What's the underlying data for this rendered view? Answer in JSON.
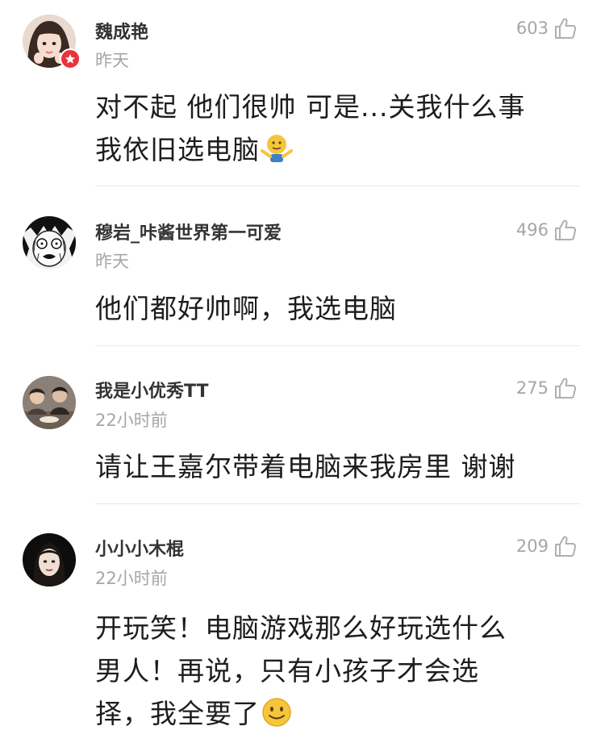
{
  "comments": [
    {
      "username": "魏成艳",
      "time": "昨天",
      "likes": "603",
      "lines": [
        "对不起 他们很帅 可是...关我什么事",
        "我依旧选电脑"
      ],
      "verified": true,
      "avatar_icon": "girl-avatar-icon",
      "trailing_emoji": "shrug-emoji-icon"
    },
    {
      "username": "穆岩_咔酱世界第一可爱",
      "time": "昨天",
      "likes": "496",
      "lines": [
        "他们都好帅啊，我选电脑"
      ],
      "avatar_icon": "manga-scared-face-icon"
    },
    {
      "username": "我是小优秀TT",
      "time": "22小时前",
      "likes": "275",
      "lines": [
        "请让王嘉尔带着电脑来我房里 谢谢"
      ],
      "avatar_icon": "group-photo-avatar-icon"
    },
    {
      "username": "小小小木棍",
      "time": "22小时前",
      "likes": "209",
      "lines": [
        "开玩笑！电脑游戏那么好玩选什么",
        "男人！再说，只有小孩子才会选",
        "择，我全要了"
      ],
      "avatar_icon": "woman-portrait-avatar-icon",
      "trailing_emoji": "smile-emoji-icon"
    }
  ],
  "colors": {
    "meta_gray": "#a6a6a6",
    "verified_badge": "#e8323c",
    "divider": "#e8e8e8"
  }
}
